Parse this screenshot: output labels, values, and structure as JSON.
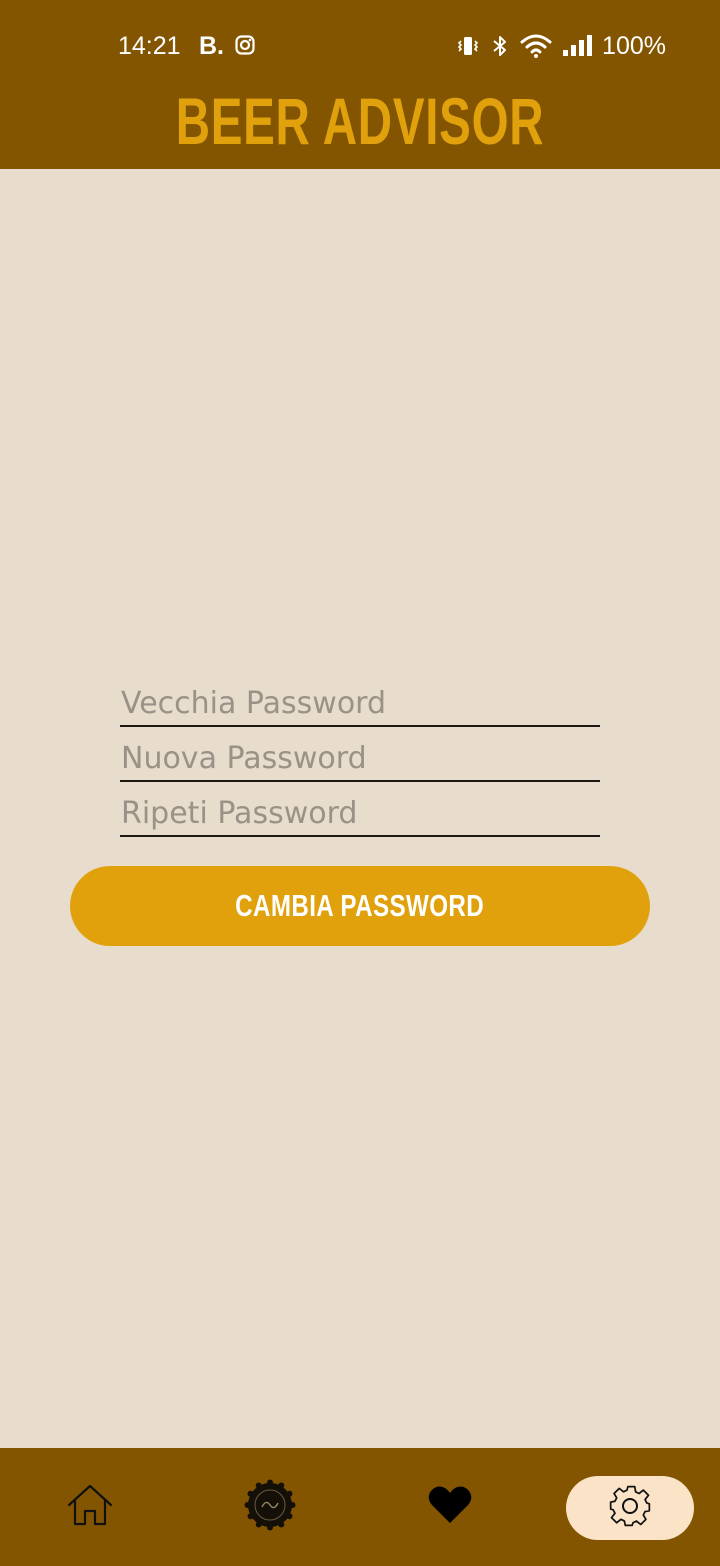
{
  "status_bar": {
    "time": "14:21",
    "app_badge": "B.",
    "battery": "100%",
    "icons": [
      "instagram-icon",
      "vibrate-icon",
      "bluetooth-icon",
      "wifi-icon",
      "signal-icon"
    ]
  },
  "header": {
    "title": "BEER ADVISOR"
  },
  "form": {
    "old_password_placeholder": "Vecchia Password",
    "new_password_placeholder": "Nuova Password",
    "repeat_password_placeholder": "Ripeti Password",
    "submit_label": "CAMBIA PASSWORD"
  },
  "bottom_nav": {
    "items": [
      "home-icon",
      "beer-cap-icon",
      "heart-icon",
      "settings-gear-icon"
    ],
    "active": "settings-gear-icon"
  },
  "colors": {
    "header_bg": "#835500",
    "accent": "#e0a10c",
    "page_bg": "#e8dccd",
    "active_nav_bg": "#fbe3c8"
  }
}
